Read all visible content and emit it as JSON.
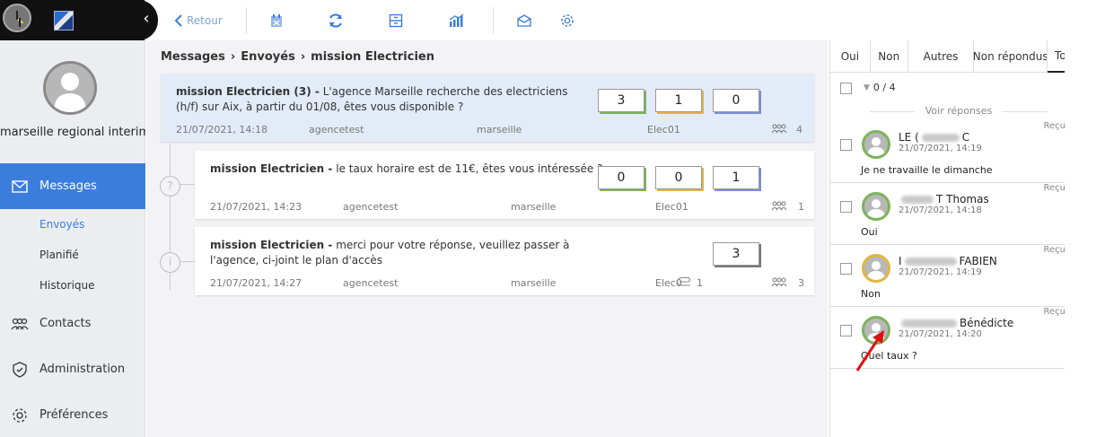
{
  "sidebar": {
    "user_name": "marseille regional interim",
    "nav": [
      {
        "label": "Messages",
        "icon": "envelope-icon"
      },
      {
        "label": "Envoyés"
      },
      {
        "label": "Planifié"
      },
      {
        "label": "Historique"
      },
      {
        "label": "Contacts",
        "icon": "contacts-icon"
      },
      {
        "label": "Administration",
        "icon": "shield-icon"
      },
      {
        "label": "Préférences",
        "icon": "gear-icon"
      }
    ]
  },
  "toolbar": {
    "back_label": "Retour"
  },
  "breadcrumb": [
    "Messages",
    "Envoyés",
    "mission Electricien"
  ],
  "messages": [
    {
      "title_bold": "mission Electricien (3) -",
      "title_text": " L'agence Marseille recherche des electriciens (h/f) sur Aix, à partir du 01/08, êtes vous disponible ?",
      "date": "21/07/2021, 14:18",
      "agency": "agencetest",
      "city": "marseille",
      "code": "Elec01",
      "count": "4",
      "stats": [
        "3",
        "1",
        "0"
      ]
    },
    {
      "title_bold": "mission Electricien -",
      "title_text": " le taux horaire est de 11€, êtes vous intéressée ?",
      "date": "21/07/2021, 14:23",
      "agency": "agencetest",
      "city": "marseille",
      "code": "Elec01",
      "count": "1",
      "stats": [
        "0",
        "0",
        "1"
      ]
    },
    {
      "title_bold": "mission Electricien -",
      "title_text": " merci pour votre réponse, veuillez passer à l'agence, ci-joint le plan d'accès",
      "date": "21/07/2021, 14:27",
      "agency": "agencetest",
      "city": "marseille",
      "code": "Elec0",
      "attach": "1",
      "count": "3",
      "stats": [
        "3"
      ]
    }
  ],
  "right": {
    "tabs": [
      "Oui",
      "Non",
      "Autres",
      "Non répondus",
      "To"
    ],
    "counter": "0 / 4",
    "voir": "Voir réponses",
    "responses": [
      {
        "name_a": "LE (",
        "name_b": "C",
        "date": "21/07/2021, 14:19",
        "text": "Je ne travaille le dimanche",
        "tag": "Reçu",
        "ring": "#7cb35c"
      },
      {
        "name_a": "",
        "name_b": "T Thomas",
        "date": "21/07/2021, 14:18",
        "text": "Oui",
        "tag": "Reçu",
        "ring": "#7cb35c"
      },
      {
        "name_a": "I",
        "name_b": "FABIEN",
        "date": "21/07/2021, 14:19",
        "text": "Non",
        "tag": "Reçu",
        "ring": "#e0b642"
      },
      {
        "name_a": "",
        "name_b": "Bénédicte",
        "date": "21/07/2021, 14:20",
        "text": "Quel taux ?",
        "tag": "Reçu",
        "ring": "#7cb35c"
      }
    ]
  },
  "colors": {
    "accent": "#3b7ddd",
    "green": "#7cb35c",
    "yellow": "#e0b642",
    "purple": "#7a8fd6",
    "gray": "#777777"
  }
}
